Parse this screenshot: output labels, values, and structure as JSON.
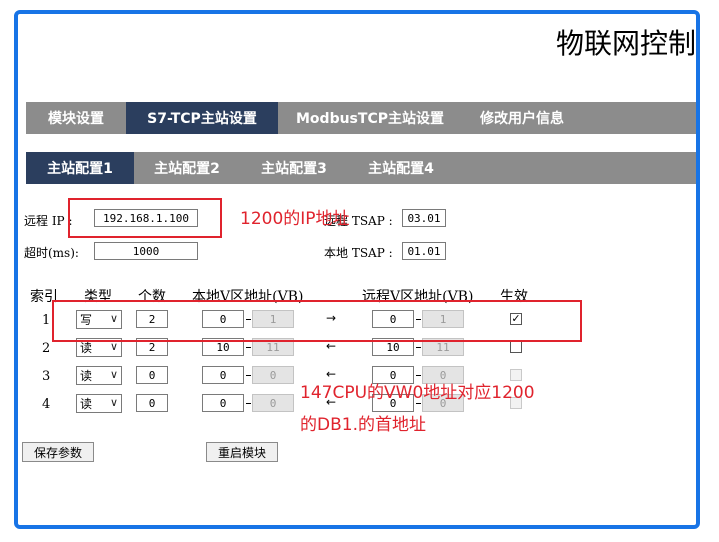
{
  "title": "物联网控制",
  "nav": {
    "tabs": [
      "模块设置",
      "S7-TCP主站设置",
      "ModbusTCP主站设置",
      "修改用户信息"
    ],
    "active": "S7-TCP主站设置"
  },
  "subnav": {
    "tabs": [
      "主站配置1",
      "主站配置2",
      "主站配置3",
      "主站配置4"
    ],
    "active": "主站配置1"
  },
  "form": {
    "remote_ip_label": "远程 IP :",
    "remote_ip_value": "192.168.1.100",
    "timeout_label": "超时(ms):",
    "timeout_value": "1000",
    "remote_tsap_label": "远程 TSAP :",
    "remote_tsap_value": "03.01",
    "local_tsap_label": "本地 TSAP :",
    "local_tsap_value": "01.01"
  },
  "table": {
    "headers": {
      "index": "索引",
      "type": "类型",
      "count": "个数",
      "local_v": "本地V区地址(VB)",
      "remote_v": "远程V区地址(VB)",
      "enable": "生效"
    },
    "rows": [
      {
        "index": "1",
        "type": "写",
        "count": "2",
        "local_start": "0",
        "local_end": "1",
        "direction": "→",
        "remote_start": "0",
        "remote_end": "1",
        "enabled": true
      },
      {
        "index": "2",
        "type": "读",
        "count": "2",
        "local_start": "10",
        "local_end": "11",
        "direction": "←",
        "remote_start": "10",
        "remote_end": "11",
        "enabled": false
      },
      {
        "index": "3",
        "type": "读",
        "count": "0",
        "local_start": "0",
        "local_end": "0",
        "direction": "←",
        "remote_start": "0",
        "remote_end": "0",
        "enabled": false
      },
      {
        "index": "4",
        "type": "读",
        "count": "0",
        "local_start": "0",
        "local_end": "0",
        "direction": "←",
        "remote_start": "0",
        "remote_end": "0",
        "enabled": false
      }
    ]
  },
  "buttons": {
    "save": "保存参数",
    "restart": "重启模块"
  },
  "annotations": {
    "ip_note": "1200的IP地址",
    "mapping_note_line1": "147CPU的VW0地址对应1200",
    "mapping_note_line2": "的DB1.的首地址"
  },
  "colors": {
    "frame": "#1874e6",
    "nav_bg": "#8c8c8c",
    "nav_active": "#2b3e5e",
    "annotation": "#e0232d"
  }
}
